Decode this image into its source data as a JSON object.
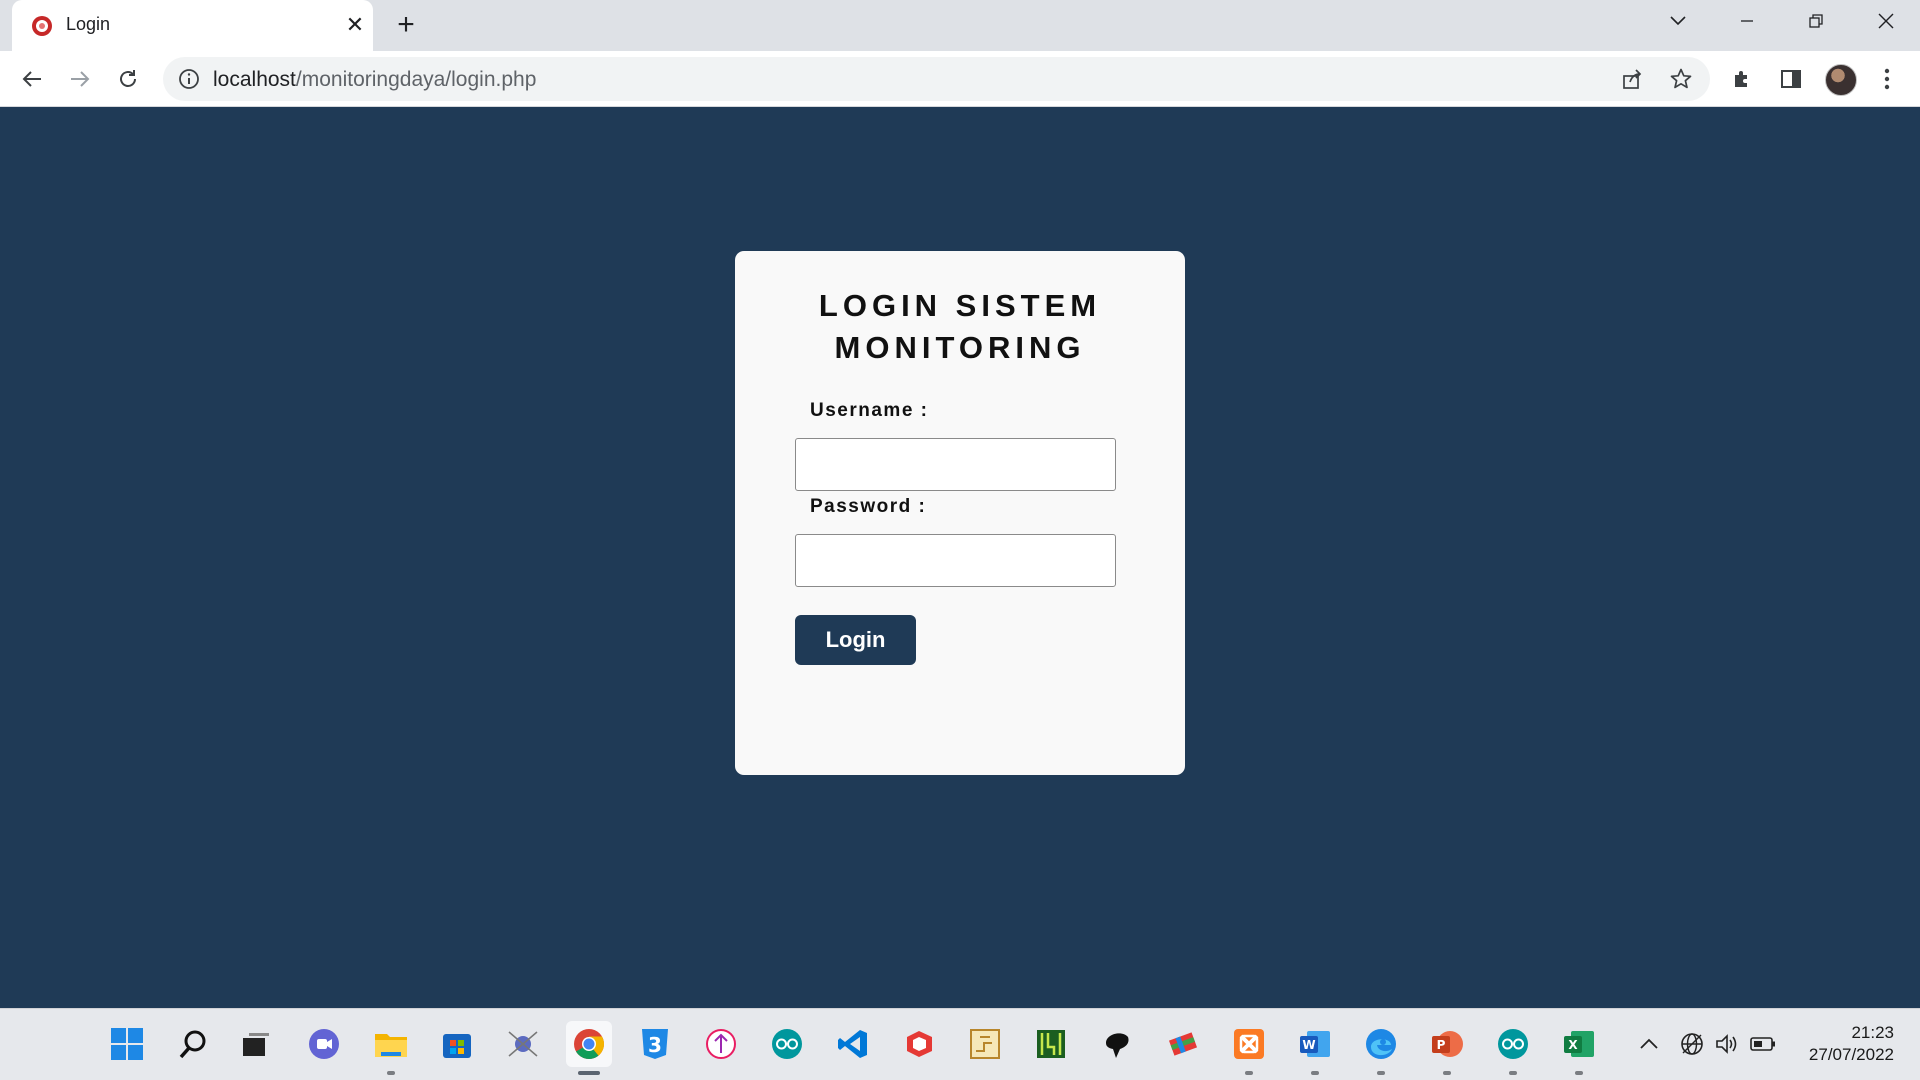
{
  "browser": {
    "tab_title": "Login",
    "tab_close": "✕",
    "new_tab": "+",
    "url_host": "localhost",
    "url_path": "/monitoringdaya/login.php"
  },
  "page": {
    "title_line1": "LOGIN SISTEM",
    "title_line2": "MONITORING",
    "username_label": "Username :",
    "username_value": "",
    "password_label": "Password :",
    "password_value": "",
    "login_button": "Login",
    "colors": {
      "background": "#1f3a56",
      "card": "#f9f9f9",
      "button": "#1f3a56"
    }
  },
  "taskbar": {
    "apps": [
      "start-icon",
      "search-icon",
      "task-view-icon",
      "teams-chat-icon",
      "file-explorer-icon",
      "microsoft-store-icon",
      "network-app-icon",
      "chrome-icon",
      "app-3-icon",
      "app-pink-icon",
      "arduino-icon",
      "vscode-icon",
      "sketchup-icon",
      "circuit-app-icon",
      "pcb-app-icon",
      "bird-app-icon",
      "flag-app-icon",
      "xampp-icon",
      "word-icon",
      "edge-icon",
      "powerpoint-icon",
      "arduino-2-icon",
      "excel-icon"
    ],
    "tray": [
      "chevron-up-icon",
      "globe-icon",
      "volume-icon",
      "battery-icon"
    ],
    "time": "21:23",
    "date": "27/07/2022"
  }
}
